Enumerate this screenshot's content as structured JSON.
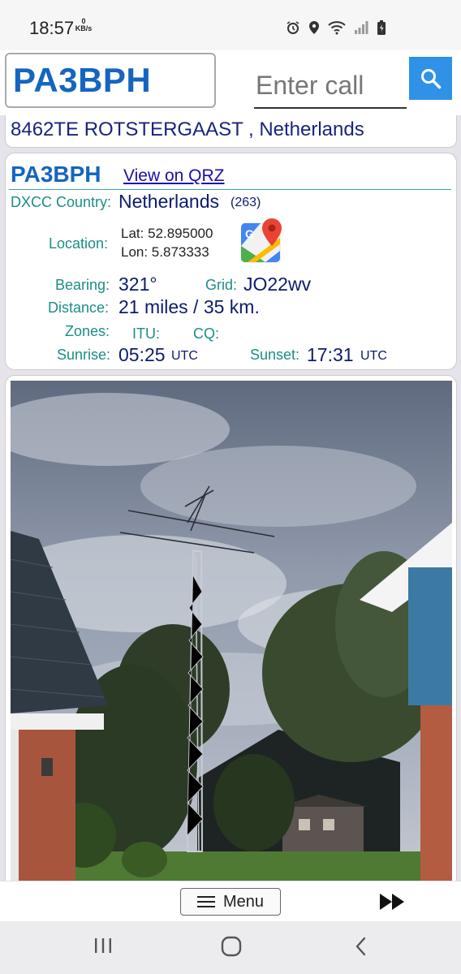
{
  "status_bar": {
    "time": "18:57",
    "kbs_value": "0",
    "kbs_unit": "KB/s",
    "icons": [
      "alarm-icon",
      "location-icon",
      "wifi-icon",
      "signal-icon",
      "battery-charging-icon"
    ]
  },
  "search": {
    "callsign": "PA3BPH",
    "placeholder": "Enter call"
  },
  "address": "8462TE ROTSTERGAAST , Netherlands",
  "info": {
    "callsign": "PA3BPH",
    "qrz_link": "View on QRZ",
    "dxcc_label": "DXCC Country:",
    "dxcc_value": "Netherlands",
    "dxcc_code": "(263)",
    "location_label": "Location:",
    "lat": "Lat: 52.895000",
    "lon": "Lon: 5.873333",
    "bearing_label": "Bearing:",
    "bearing_value": "321°",
    "grid_label": "Grid:",
    "grid_value": "JO22wv",
    "distance_label": "Distance:",
    "distance_value": "21 miles / 35 km.",
    "zones_label": "Zones:",
    "itu_label": "ITU:",
    "cq_label": "CQ:",
    "sunrise_label": "Sunrise:",
    "sunrise_value": "05:25",
    "sunset_label": "Sunset:",
    "sunset_value": "17:31",
    "utc": "UTC"
  },
  "bottom": {
    "menu_label": "Menu"
  },
  "colors": {
    "accent": "#1565c0",
    "label_teal": "#1b8e86",
    "value_navy": "#0d1b6e",
    "search_button": "#2f92e6"
  }
}
